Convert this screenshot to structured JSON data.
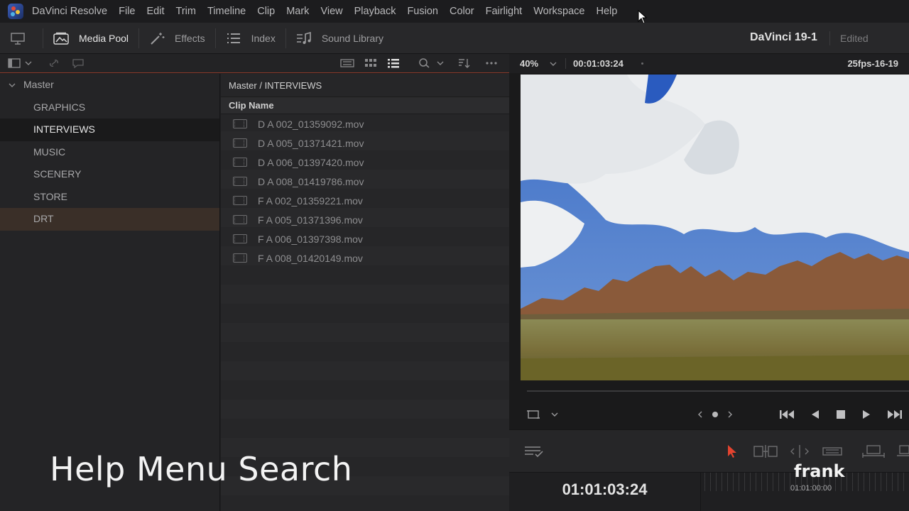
{
  "menubar": {
    "items": [
      "DaVinci Resolve",
      "File",
      "Edit",
      "Trim",
      "Timeline",
      "Clip",
      "Mark",
      "View",
      "Playback",
      "Fusion",
      "Color",
      "Fairlight",
      "Workspace",
      "Help"
    ]
  },
  "toolbar": {
    "media_pool": "Media Pool",
    "effects": "Effects",
    "index": "Index",
    "sound_library": "Sound Library",
    "project_title": "DaVinci 19-1",
    "project_status": "Edited"
  },
  "viewer": {
    "zoom": "40%",
    "timecode": "00:01:03:24",
    "timeline_name": "25fps-16-19"
  },
  "bins": {
    "root": "Master",
    "items": [
      {
        "label": "GRAPHICS",
        "state": "normal"
      },
      {
        "label": "INTERVIEWS",
        "state": "selected"
      },
      {
        "label": "MUSIC",
        "state": "normal"
      },
      {
        "label": "SCENERY",
        "state": "normal"
      },
      {
        "label": "STORE",
        "state": "normal"
      },
      {
        "label": "DRT",
        "state": "highlight"
      }
    ]
  },
  "clips": {
    "breadcrumb": "Master / INTERVIEWS",
    "column_header": "Clip Name",
    "items": [
      "D A 002_01359092.mov",
      "D A 005_01371421.mov",
      "D A 006_01397420.mov",
      "D A 008_01419786.mov",
      "F A 002_01359221.mov",
      "F A 005_01371396.mov",
      "F A 006_01397398.mov",
      "F A 008_01420149.mov"
    ]
  },
  "timeline": {
    "timecode": "01:01:03:24",
    "ruler_label": "01:01:00:00"
  },
  "overlay": {
    "caption": "Help Menu Search",
    "watermark": "frank"
  },
  "colors": {
    "accent_red": "#e3432f",
    "drt_bin": "#3a2f28",
    "selected_bin": "#1a1a1b"
  }
}
